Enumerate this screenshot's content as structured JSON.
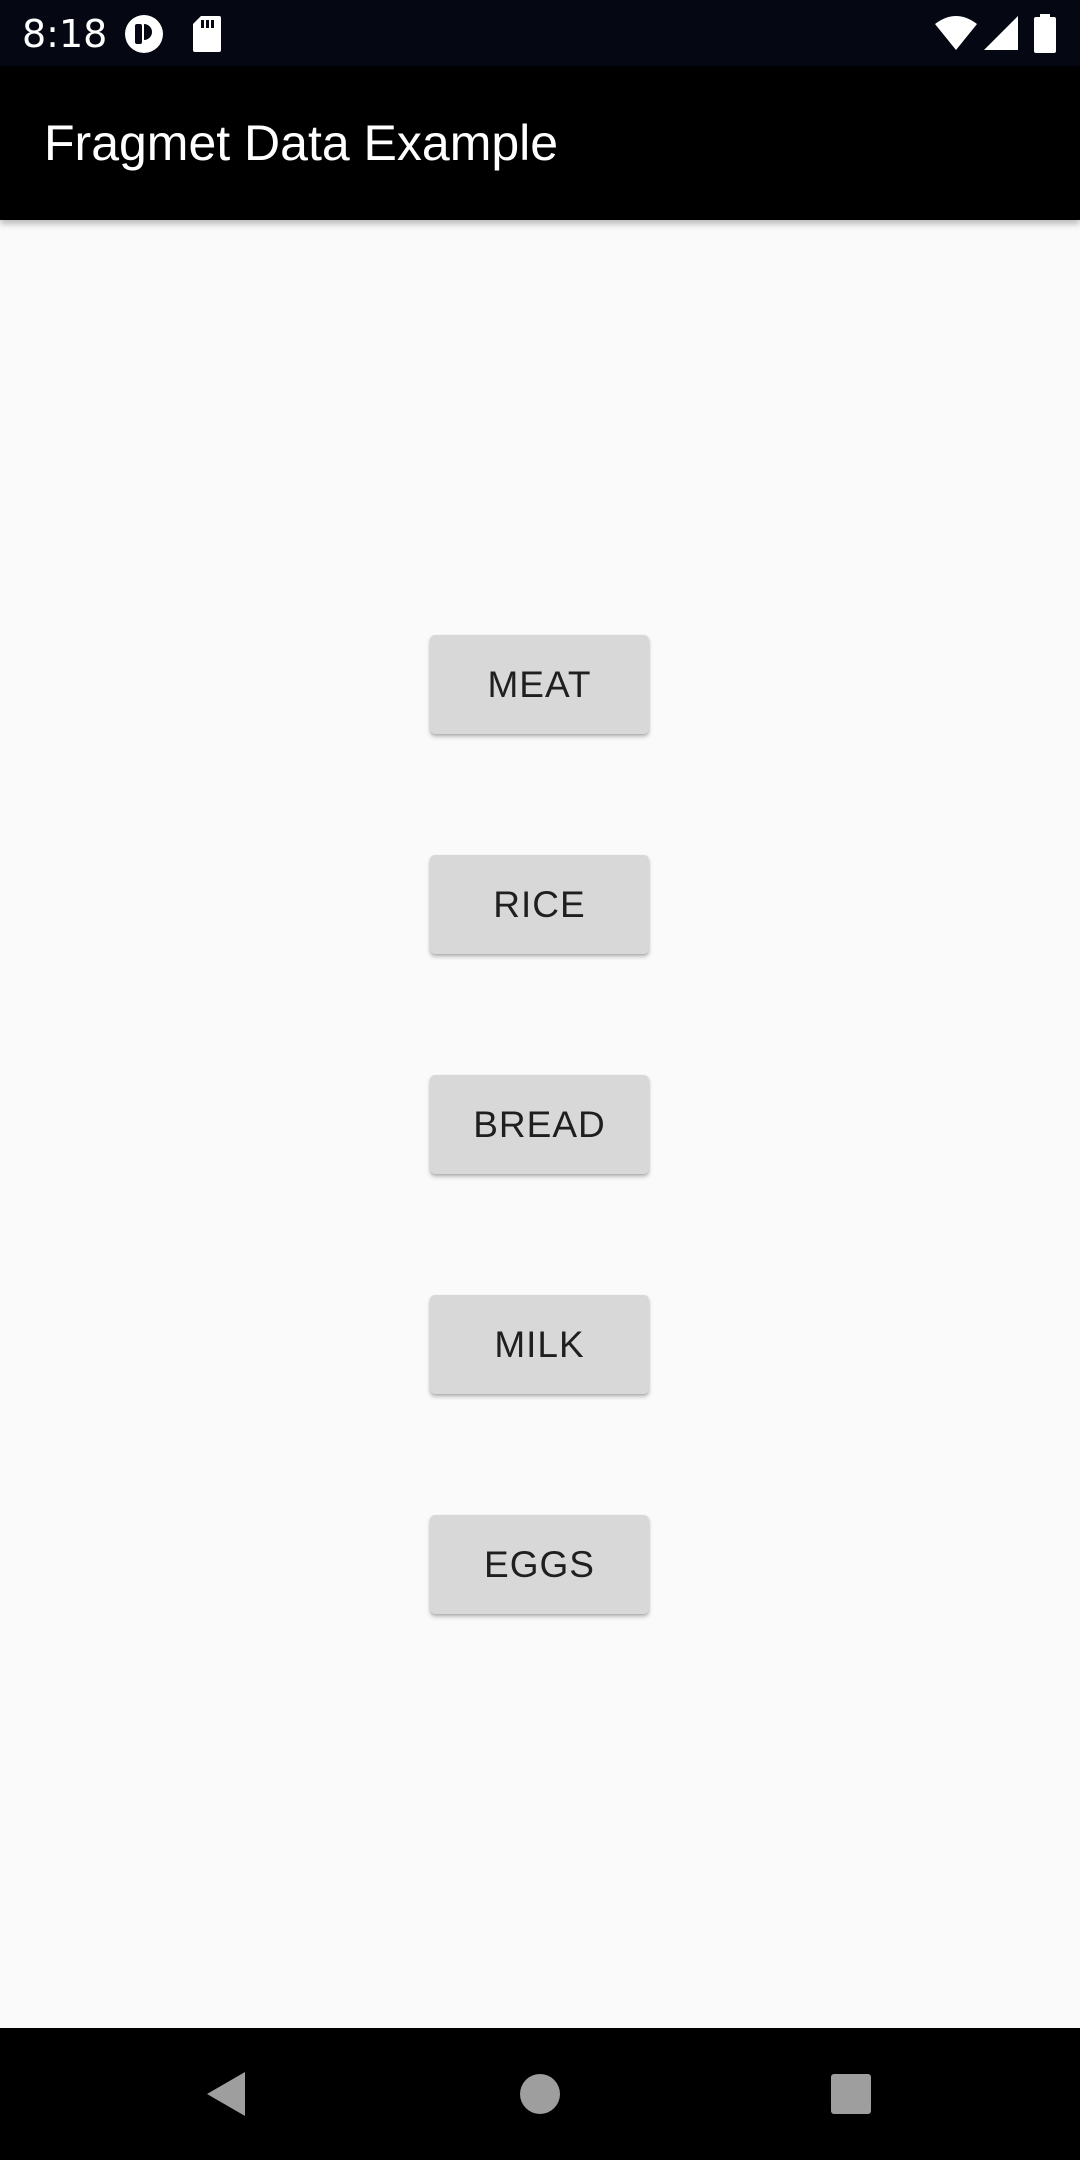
{
  "status_bar": {
    "time": "8:18",
    "left_icons": [
      "privacy-indicator-icon",
      "sd-card-icon"
    ],
    "right_icons": [
      "wifi-icon",
      "cell-signal-icon",
      "battery-icon"
    ]
  },
  "app_bar": {
    "title": "Fragmet Data Example"
  },
  "buttons": [
    {
      "label": "MEAT"
    },
    {
      "label": "RICE"
    },
    {
      "label": "BREAD"
    },
    {
      "label": "MILK"
    },
    {
      "label": "EGGS"
    }
  ],
  "nav_bar": {
    "icons": [
      "back-icon",
      "home-icon",
      "recents-icon"
    ]
  },
  "colors": {
    "status_bar_bg": "#050813",
    "app_bar_bg": "#000000",
    "content_bg": "#fafafa",
    "button_bg": "#d8d8d8",
    "button_text": "#1f1f1f",
    "nav_icon": "#9e9e9e"
  }
}
